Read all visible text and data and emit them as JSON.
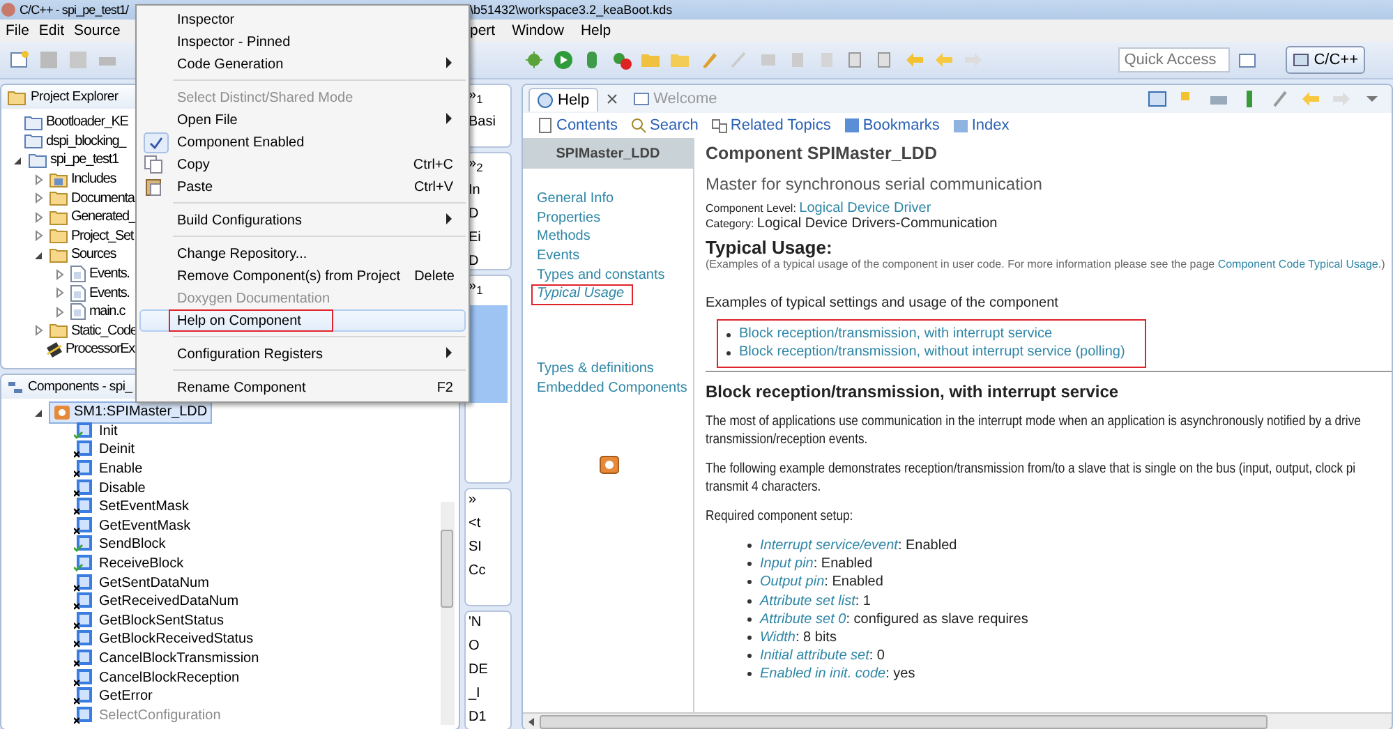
{
  "window": {
    "title_start": "C/C++ - spi_pe_test1/",
    "title_end": "\\b51432\\workspace3.2_keaBoot.kds"
  },
  "menu_bar": {
    "items_left": [
      "File",
      "Edit",
      "Source"
    ],
    "items_right": [
      "pert",
      "Window",
      "Help"
    ]
  },
  "toolbar": {
    "quick_access": {
      "placeholder": "Quick Access"
    },
    "perspective": {
      "label": "C/C++",
      "selected": true
    }
  },
  "project_explorer": {
    "title": "Project Explorer",
    "items": [
      {
        "label": "Bootloader_KE",
        "kind": "project"
      },
      {
        "label": "dspi_blocking_",
        "kind": "project"
      },
      {
        "label": "spi_pe_test1",
        "kind": "project",
        "expanded": true,
        "children": [
          {
            "label": "Includes",
            "kind": "include",
            "expanded": false
          },
          {
            "label": "Documenta",
            "kind": "folder",
            "expanded": false
          },
          {
            "label": "Generated_",
            "kind": "folder",
            "expanded": false
          },
          {
            "label": "Project_Set",
            "kind": "folder",
            "expanded": false
          },
          {
            "label": "Sources",
            "kind": "folder",
            "expanded": true,
            "children": [
              {
                "label": "Events.",
                "kind": "file",
                "expanded": false
              },
              {
                "label": "Events.",
                "kind": "file",
                "expanded": false
              },
              {
                "label": "main.c",
                "kind": "file",
                "expanded": false
              }
            ]
          },
          {
            "label": "Static_Code",
            "kind": "folder",
            "expanded": false
          },
          {
            "label": "ProcessorEx",
            "kind": "chip"
          }
        ]
      }
    ]
  },
  "components": {
    "title": "Components - spi_",
    "root": {
      "label": "SM1:SPIMaster_LDD",
      "selected": true,
      "expanded": true,
      "children": [
        {
          "label": "Init",
          "enabled": true,
          "disabled": false
        },
        {
          "label": "Deinit",
          "enabled": false,
          "disabled": false
        },
        {
          "label": "Enable",
          "enabled": false,
          "disabled": false
        },
        {
          "label": "Disable",
          "enabled": false,
          "disabled": false
        },
        {
          "label": "SetEventMask",
          "enabled": false,
          "disabled": false
        },
        {
          "label": "GetEventMask",
          "enabled": false,
          "disabled": false
        },
        {
          "label": "SendBlock",
          "enabled": true,
          "disabled": false
        },
        {
          "label": "ReceiveBlock",
          "enabled": true,
          "disabled": false
        },
        {
          "label": "GetSentDataNum",
          "enabled": false,
          "disabled": false
        },
        {
          "label": "GetReceivedDataNum",
          "enabled": false,
          "disabled": false
        },
        {
          "label": "GetBlockSentStatus",
          "enabled": false,
          "disabled": false
        },
        {
          "label": "GetBlockReceivedStatus",
          "enabled": false,
          "disabled": false
        },
        {
          "label": "CancelBlockTransmission",
          "enabled": false,
          "disabled": false
        },
        {
          "label": "CancelBlockReception",
          "enabled": false,
          "disabled": false
        },
        {
          "label": "GetError",
          "enabled": false,
          "disabled": false
        },
        {
          "label": "SelectConfiguration",
          "enabled": false,
          "disabled": true
        }
      ]
    }
  },
  "side_strip": {
    "panels": [
      {
        "tab": "»$_{1}$",
        "texts": [
          "Basi"
        ]
      },
      {
        "tab": "»$_{2}$",
        "texts": [
          "In",
          "D",
          "Ei",
          "D"
        ]
      },
      {
        "tab": "»$_{1}$"
      },
      {
        "tab": "»",
        "texts": [
          "<t",
          "SI",
          "Cc"
        ]
      },
      {
        "texts": [
          "'N",
          "O",
          "DE",
          "_I",
          "D1"
        ]
      }
    ]
  },
  "help": {
    "tabs": [
      {
        "label": "Help",
        "selected": true
      },
      {
        "label": "Welcome",
        "selected": false
      }
    ],
    "toolbar": [
      "Contents",
      "Search",
      "Related Topics",
      "Bookmarks",
      "Index"
    ],
    "nav": {
      "header": "SPIMaster_LDD",
      "groups": [
        [
          {
            "label": "General Info",
            "selected": false,
            "highlighted": false
          },
          {
            "label": "Properties",
            "selected": false,
            "highlighted": false
          },
          {
            "label": "Methods",
            "selected": false,
            "highlighted": false
          },
          {
            "label": "Events",
            "selected": false,
            "highlighted": false
          },
          {
            "label": "Types and constants",
            "selected": false,
            "highlighted": false
          },
          {
            "label": "Typical Usage",
            "selected": true,
            "highlighted": true
          }
        ],
        [
          {
            "label": "Types & definitions",
            "selected": false,
            "highlighted": false
          },
          {
            "label": "Embedded Components",
            "selected": false,
            "highlighted": false
          }
        ]
      ]
    },
    "content": {
      "title": "Component SPIMaster_LDD",
      "subtitle": "Master for synchronous serial communication",
      "level_label": "Component Level:",
      "level_value": "Logical Device Driver",
      "category_label": "Category:",
      "category_value": "Logical Device Drivers-Communication",
      "usage_heading": "Typical Usage:",
      "usage_note": "(Examples of a typical usage of the component in user code. For more information please see the page ",
      "usage_note_link": "Component Code Typical Usage",
      "usage_note_end": ".)",
      "examples_intro": "Examples of typical settings and usage of the component",
      "examples": {
        "highlighted": true,
        "links": [
          "Block reception/transmission, with interrupt service",
          "Block reception/transmission, without interrupt service (polling)"
        ]
      },
      "section_heading": "Block reception/transmission, with interrupt service",
      "paragraphs": [
        [
          "The most of applications use communication in the interrupt mode when an application is asynchronously notified by a drive",
          "transmission/reception events."
        ],
        [
          "The following example demonstrates reception/transmission from/to a slave that is single on the bus (input, output, clock pi",
          "transmit 4 characters."
        ],
        [
          "Required component setup:"
        ]
      ],
      "setup": [
        {
          "term": "Interrupt service/event",
          "value": ": Enabled"
        },
        {
          "term": "Input pin",
          "value": ": Enabled"
        },
        {
          "term": "Output pin",
          "value": ": Enabled"
        },
        {
          "term": "Attribute set list",
          "value": ": 1"
        },
        {
          "term": "Attribute set 0",
          "value": ": configured as slave requires"
        },
        {
          "term": "Width",
          "value": ": 8 bits"
        },
        {
          "term": "Initial attribute set",
          "value": ": 0"
        },
        {
          "term": "Enabled in init. code",
          "value": ": yes"
        }
      ]
    }
  },
  "context_menu": {
    "items": [
      {
        "kind": "item",
        "label": "Inspector",
        "submenu": false,
        "disabled": false,
        "checked": false,
        "selected": false,
        "highlighted": false
      },
      {
        "kind": "item",
        "label": "Inspector - Pinned",
        "submenu": false,
        "disabled": false,
        "checked": false,
        "selected": false,
        "highlighted": false
      },
      {
        "kind": "item",
        "label": "Code Generation",
        "submenu": true,
        "disabled": false,
        "checked": false,
        "selected": false,
        "highlighted": false
      },
      {
        "kind": "separator"
      },
      {
        "kind": "item",
        "label": "Select Distinct/Shared Mode",
        "submenu": false,
        "disabled": true,
        "checked": false,
        "selected": false,
        "highlighted": false
      },
      {
        "kind": "item",
        "label": "Open File",
        "submenu": true,
        "disabled": false,
        "checked": false,
        "selected": false,
        "highlighted": false
      },
      {
        "kind": "item",
        "label": "Component Enabled",
        "submenu": false,
        "disabled": false,
        "checked": true,
        "selected": false,
        "highlighted": false
      },
      {
        "kind": "copy",
        "label": "Copy",
        "shortcut": "Ctrl+C",
        "submenu": false,
        "disabled": false,
        "checked": false,
        "selected": false,
        "highlighted": false
      },
      {
        "kind": "paste",
        "label": "Paste",
        "shortcut": "Ctrl+V",
        "submenu": false,
        "disabled": false,
        "checked": false,
        "selected": false,
        "highlighted": false
      },
      {
        "kind": "separator"
      },
      {
        "kind": "item",
        "label": "Build Configurations",
        "submenu": true,
        "disabled": false,
        "checked": false,
        "selected": false,
        "highlighted": false
      },
      {
        "kind": "separator"
      },
      {
        "kind": "item",
        "label": "Change Repository...",
        "submenu": false,
        "disabled": false,
        "checked": false,
        "selected": false,
        "highlighted": false
      },
      {
        "kind": "item",
        "label": "Remove Component(s) from Project",
        "shortcut": "Delete",
        "submenu": false,
        "disabled": false,
        "checked": false,
        "selected": false,
        "highlighted": false
      },
      {
        "kind": "item",
        "label": "Doxygen Documentation",
        "submenu": false,
        "disabled": true,
        "checked": false,
        "selected": false,
        "highlighted": false
      },
      {
        "kind": "item",
        "label": "Help on Component",
        "submenu": false,
        "disabled": false,
        "checked": false,
        "selected": true,
        "highlighted": true
      },
      {
        "kind": "separator"
      },
      {
        "kind": "item",
        "label": "Configuration Registers",
        "submenu": true,
        "disabled": false,
        "checked": false,
        "selected": false,
        "highlighted": false
      },
      {
        "kind": "separator"
      },
      {
        "kind": "item",
        "label": "Rename Component",
        "shortcut": "F2",
        "submenu": false,
        "disabled": false,
        "checked": false,
        "selected": false,
        "highlighted": false
      }
    ]
  }
}
